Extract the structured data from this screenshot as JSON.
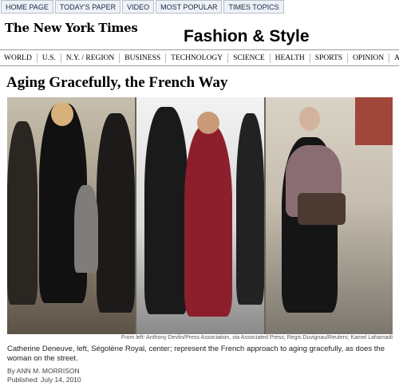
{
  "top_tabs": [
    "HOME PAGE",
    "TODAY'S PAPER",
    "VIDEO",
    "MOST POPULAR",
    "TIMES TOPICS"
  ],
  "masthead": {
    "logo": "The New York Times",
    "section": "Fashion & Style"
  },
  "nav": [
    "WORLD",
    "U.S.",
    "N.Y. / REGION",
    "BUSINESS",
    "TECHNOLOGY",
    "SCIENCE",
    "HEALTH",
    "SPORTS",
    "OPINION",
    "A"
  ],
  "article": {
    "headline": "Aging Gracefully, the French Way",
    "photo_credit": "From left: Anthony Devlin/Press Association, via Associated Press; Regis Duvignau/Reuters; Kamel Lahamadi",
    "caption": "Catherine Deneuve, left, Ségolène Royal, center; represent the French approach to aging gracefully, as does the woman on the street.",
    "byline": "By ANN M. MORRISON",
    "published": "Published: July 14, 2010"
  },
  "colors": {
    "tab_bg": "#eef1f6",
    "tab_border": "#b8bfca",
    "rule": "#999999"
  }
}
